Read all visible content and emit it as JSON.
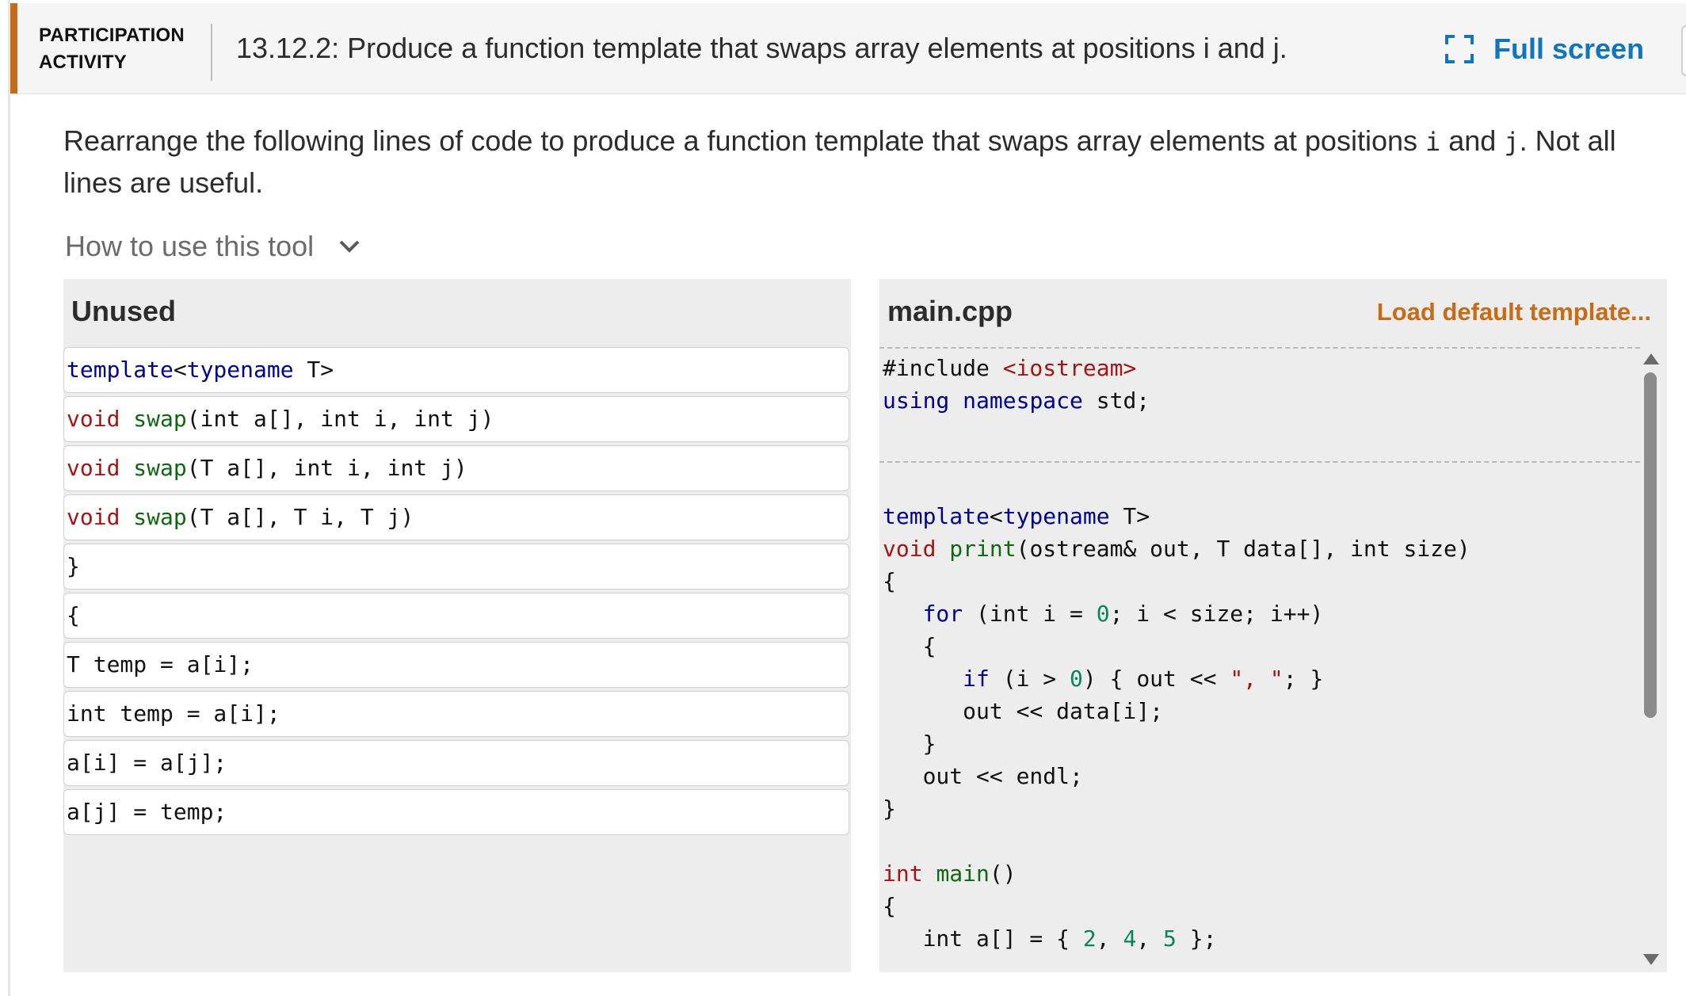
{
  "header": {
    "activity_type_line1": "PARTICIPATION",
    "activity_type_line2": "ACTIVITY",
    "title": "13.12.2: Produce a function template that swaps array elements at positions i and j.",
    "fullscreen_label": "Full screen"
  },
  "instructions": {
    "part1": "Rearrange the following lines of code to produce a function template that swaps array elements at positions ",
    "var_i": "i",
    "part2": " and ",
    "var_j": "j",
    "part3": ". Not all lines are useful."
  },
  "how_to_label": "How to use this tool",
  "unused": {
    "title": "Unused",
    "lines": [
      "template<typename T>",
      "void swap(int a[], int i, int j)",
      "void swap(T a[], int i, int j)",
      "void swap(T a[], T i, T j)",
      "}",
      "{",
      "T temp = a[i];",
      "int temp = a[i];",
      "a[i] = a[j];",
      "a[j] = temp;"
    ]
  },
  "editor": {
    "filename": "main.cpp",
    "load_default_label": "Load default template...",
    "lines": [
      "#include <iostream>",
      "using namespace std;",
      "template<typename T>",
      "void print(ostream& out, T data[], int size)",
      "{",
      "   for (int i = 0; i < size; i++)",
      "   {",
      "      if (i > 0) { out << \", \"; }",
      "      out << data[i];",
      "   }",
      "   out << endl;",
      "}",
      "int main()",
      "{",
      "   int a[] = { 2, 4, 5 };"
    ]
  },
  "colors": {
    "accent_orange": "#c76b16",
    "link_blue": "#0f75bc",
    "keyword_blue": "#00008b",
    "keyword_red": "#a31515",
    "function_green": "#116611",
    "number_teal": "#098658"
  },
  "icons": {
    "fullscreen": "fullscreen-icon",
    "how_to_toggle": "chevron-down-icon"
  }
}
